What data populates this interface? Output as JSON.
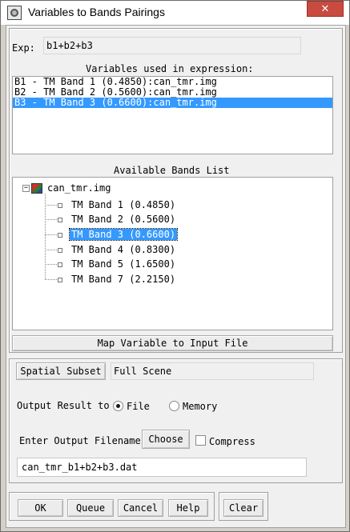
{
  "window": {
    "title": "Variables to Bands Pairings",
    "close_label": "✕"
  },
  "expression": {
    "label": "Exp:",
    "value": "b1+b2+b3"
  },
  "variables": {
    "heading": "Variables used in expression:",
    "items": [
      {
        "label": "B1 - TM Band 1 (0.4850):can_tmr.img",
        "selected": false
      },
      {
        "label": "B2 - TM Band 2 (0.5600):can_tmr.img",
        "selected": false
      },
      {
        "label": "B3 - TM Band 3 (0.6600):can_tmr.img",
        "selected": true
      }
    ]
  },
  "bands": {
    "heading": "Available Bands List",
    "collapse_symbol": "−",
    "file": "can_tmr.img",
    "items": [
      {
        "label": "TM Band 1 (0.4850)",
        "selected": false
      },
      {
        "label": "TM Band 2 (0.5600)",
        "selected": false
      },
      {
        "label": "TM Band 3 (0.6600)",
        "selected": true
      },
      {
        "label": "TM Band 4 (0.8300)",
        "selected": false
      },
      {
        "label": "TM Band 5 (1.6500)",
        "selected": false
      },
      {
        "label": "TM Band 7 (2.2150)",
        "selected": false
      }
    ]
  },
  "map_button": "Map Variable to Input File",
  "subset": {
    "button": "Spatial Subset",
    "value": "Full Scene"
  },
  "output": {
    "label": "Output Result to",
    "option_file": "File",
    "option_memory": "Memory",
    "selected": "File"
  },
  "filename": {
    "label": "Enter Output Filename",
    "choose": "Choose",
    "compress": "Compress",
    "compress_checked": false,
    "value": "can_tmr_b1+b2+b3.dat"
  },
  "footer": {
    "ok": "OK",
    "queue": "Queue",
    "cancel": "Cancel",
    "help": "Help",
    "clear": "Clear"
  },
  "colors": {
    "selection": "#3399ff",
    "close": "#c94a3f"
  }
}
